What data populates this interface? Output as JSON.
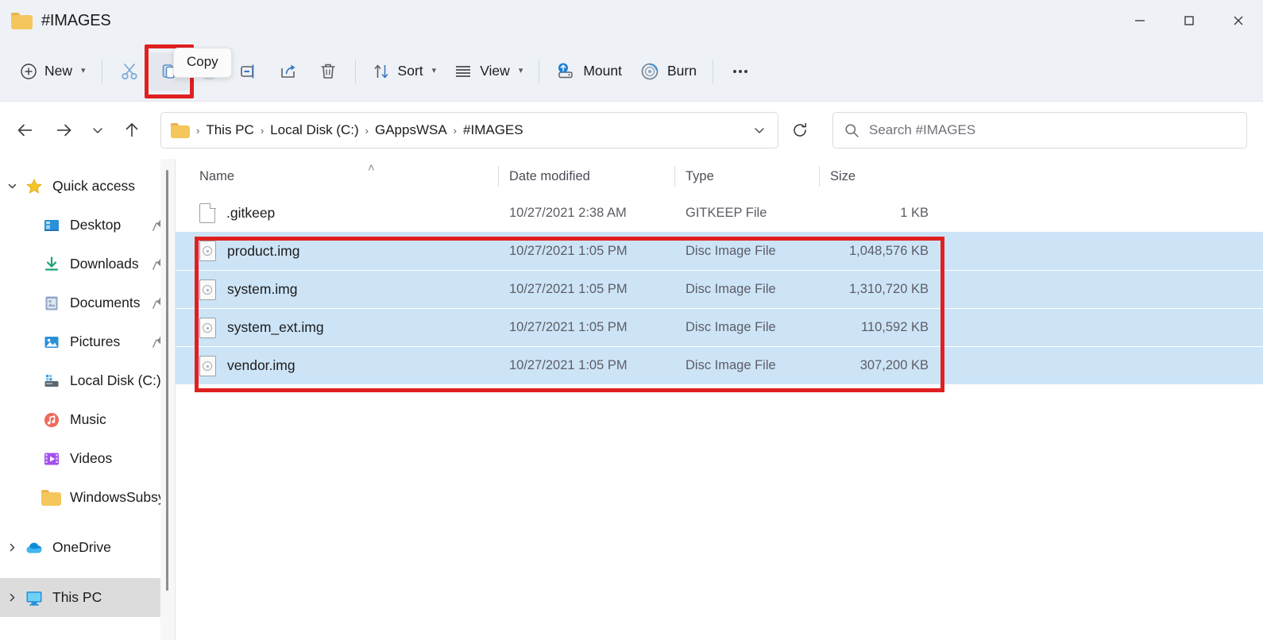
{
  "window": {
    "title": "#IMAGES",
    "folder_icon": "folder-icon",
    "minimize_label": "Minimize",
    "maximize_label": "Maximize",
    "close_label": "Close"
  },
  "tooltip": {
    "text": "Copy"
  },
  "toolbar": {
    "new_label": "New",
    "cut_label": "Cut",
    "copy_label": "Copy",
    "paste_label": "Paste",
    "rename_label": "Rename",
    "share_label": "Share",
    "delete_label": "Delete",
    "sort_label": "Sort",
    "view_label": "View",
    "mount_label": "Mount",
    "burn_label": "Burn",
    "more_label": "See more",
    "highlight_color": "#e02020"
  },
  "navbar": {
    "back_label": "Back",
    "forward_label": "Forward",
    "recent_label": "Recent locations",
    "up_label": "Up to Local Disk (C:)",
    "breadcrumb": [
      "This PC",
      "Local Disk (C:)",
      "GAppsWSA",
      "#IMAGES"
    ],
    "breadcrumb_separator": "›",
    "dropdown_label": "Previous locations",
    "refresh_label": "Refresh"
  },
  "search": {
    "placeholder": "Search #IMAGES",
    "icon": "search-icon"
  },
  "sidebar": {
    "groups": [
      {
        "name": "Quick access",
        "icon": "star-icon",
        "expanded": true,
        "expander": "⌄",
        "items": [
          {
            "label": "Desktop",
            "icon": "desktop-icon",
            "pinned": true
          },
          {
            "label": "Downloads",
            "icon": "download-icon",
            "pinned": true
          },
          {
            "label": "Documents",
            "icon": "documents-icon",
            "pinned": true
          },
          {
            "label": "Pictures",
            "icon": "pictures-icon",
            "pinned": true
          },
          {
            "label": "Local Disk (C:)",
            "icon": "drive-icon",
            "pinned": false
          },
          {
            "label": "Music",
            "icon": "music-icon",
            "pinned": false
          },
          {
            "label": "Videos",
            "icon": "videos-icon",
            "pinned": false
          },
          {
            "label": "WindowsSubsy",
            "icon": "folder-icon",
            "pinned": false
          }
        ]
      },
      {
        "name": "OneDrive",
        "icon": "onedrive-icon",
        "expanded": false,
        "expander": "›",
        "items": []
      },
      {
        "name": "This PC",
        "icon": "thispc-icon",
        "expanded": false,
        "expander": "›",
        "selected": true,
        "items": []
      }
    ]
  },
  "filelist": {
    "columns": [
      {
        "key": "name",
        "label": "Name",
        "sorted": true,
        "sort_direction": "asc",
        "sort_glyph": "˄"
      },
      {
        "key": "date",
        "label": "Date modified"
      },
      {
        "key": "type",
        "label": "Type"
      },
      {
        "key": "size",
        "label": "Size"
      }
    ],
    "rows": [
      {
        "name": ".gitkeep",
        "date": "10/27/2021 2:38 AM",
        "type": "GITKEEP File",
        "size": "1 KB",
        "icon": "generic-file-icon",
        "selected": false
      },
      {
        "name": "product.img",
        "date": "10/27/2021 1:05 PM",
        "type": "Disc Image File",
        "size": "1,048,576 KB",
        "icon": "disc-image-icon",
        "selected": true
      },
      {
        "name": "system.img",
        "date": "10/27/2021 1:05 PM",
        "type": "Disc Image File",
        "size": "1,310,720 KB",
        "icon": "disc-image-icon",
        "selected": true
      },
      {
        "name": "system_ext.img",
        "date": "10/27/2021 1:05 PM",
        "type": "Disc Image File",
        "size": "110,592 KB",
        "icon": "disc-image-icon",
        "selected": true
      },
      {
        "name": "vendor.img",
        "date": "10/27/2021 1:05 PM",
        "type": "Disc Image File",
        "size": "307,200 KB",
        "icon": "disc-image-icon",
        "selected": true
      }
    ],
    "selection_highlight_color": "#e02020",
    "selection_row_color": "#cde4f7"
  }
}
